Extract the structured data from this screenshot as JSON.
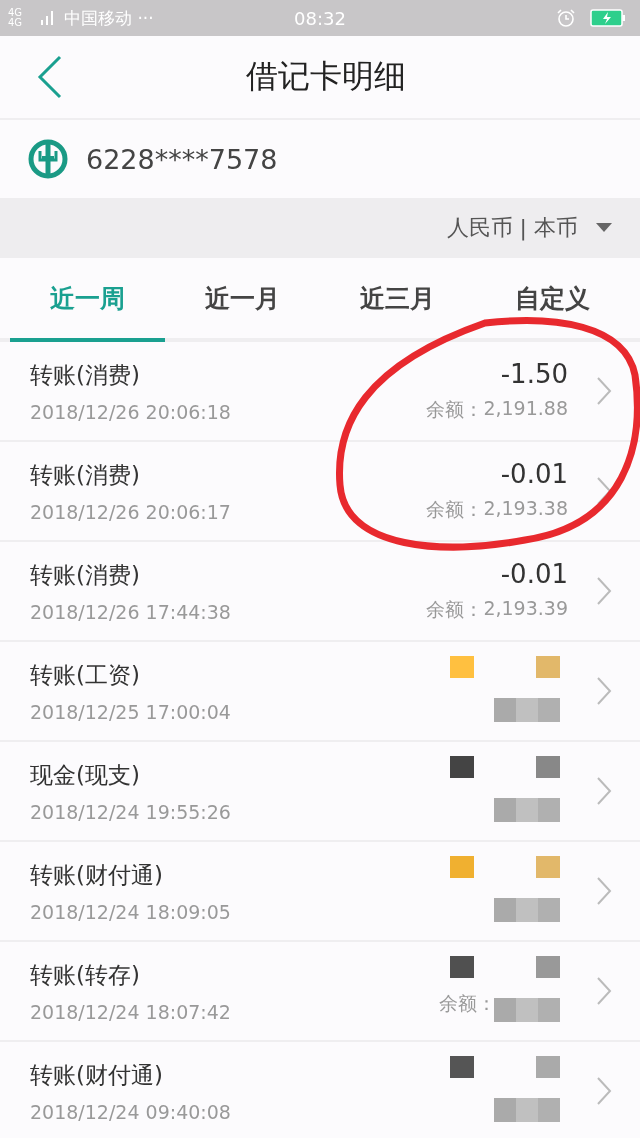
{
  "status_bar": {
    "network": "4G 4G",
    "carrier": "中国移动 ···",
    "time": "08:32"
  },
  "header": {
    "title": "借记卡明细"
  },
  "card": {
    "number": "6228****7578"
  },
  "currency": {
    "label": "人民币 | 本币"
  },
  "tabs": [
    {
      "label": "近一周",
      "selected": true
    },
    {
      "label": "近一月",
      "selected": false
    },
    {
      "label": "近三月",
      "selected": false
    },
    {
      "label": "自定义",
      "selected": false
    }
  ],
  "transactions": [
    {
      "type": "转账(消费)",
      "time": "2018/12/26 20:06:18",
      "amount": "-1.50",
      "balance_label": "余额：",
      "balance": "2,191.88",
      "redacted": false
    },
    {
      "type": "转账(消费)",
      "time": "2018/12/26 20:06:17",
      "amount": "-0.01",
      "balance_label": "余额：",
      "balance": "2,193.38",
      "redacted": false
    },
    {
      "type": "转账(消费)",
      "time": "2018/12/26 17:44:38",
      "amount": "-0.01",
      "balance_label": "余额：",
      "balance": "2,193.39",
      "redacted": false
    },
    {
      "type": "转账(工资)",
      "time": "2018/12/25 17:00:04",
      "redacted": true
    },
    {
      "type": "现金(现支)",
      "time": "2018/12/24 19:55:26",
      "redacted": true
    },
    {
      "type": "转账(财付通)",
      "time": "2018/12/24 18:09:05",
      "redacted": true
    },
    {
      "type": "转账(转存)",
      "time": "2018/12/24 18:07:42",
      "balance_label": "余额：",
      "redacted": true
    },
    {
      "type": "转账(财付通)",
      "time": "2018/12/24 09:40:08",
      "redacted": true
    }
  ]
}
